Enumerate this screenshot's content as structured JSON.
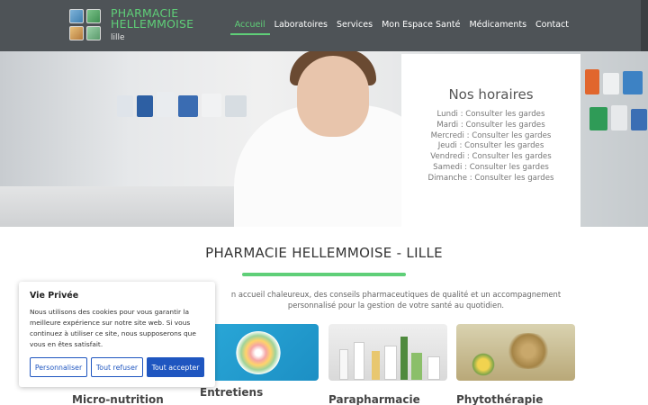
{
  "header": {
    "brand_name": "PHARMACIE HELLEMMOISE",
    "brand_city": "lille",
    "nav": [
      "Accueil",
      "Laboratoires",
      "Services",
      "Mon Espace Santé",
      "Médicaments",
      "Contact"
    ],
    "active_nav": "Accueil",
    "accent_color": "#5fcf78"
  },
  "hours": {
    "title": "Nos horaires",
    "lines": [
      "Lundi : Consulter les gardes",
      "Mardi : Consulter les gardes",
      "Mercredi : Consulter les gardes",
      "Jeudi : Consulter les gardes",
      "Vendredi : Consulter les gardes",
      "Samedi : Consulter les gardes",
      "Dimanche : Consulter les gardes"
    ]
  },
  "main": {
    "title": "PHARMACIE HELLEMMOISE - LILLE",
    "intro": "n accueil chaleureux, des conseils pharmaceutiques de qualité et un accompagnement personnalisé pour la gestion de votre santé au quotidien."
  },
  "cards": [
    {
      "title": "Micro-nutrition"
    },
    {
      "title": "Entretiens"
    },
    {
      "title": "Parapharmacie"
    },
    {
      "title": "Phytothérapie"
    }
  ],
  "cookie": {
    "title": "Vie Privée",
    "text": "Nous utilisons des cookies pour vous garantir la meilleure expérience sur notre site web. Si vous continuez à utiliser ce site, nous supposerons que vous en êtes satisfait.",
    "btn_customize": "Personnaliser",
    "btn_reject": "Tout refuser",
    "btn_accept": "Tout accepter"
  }
}
